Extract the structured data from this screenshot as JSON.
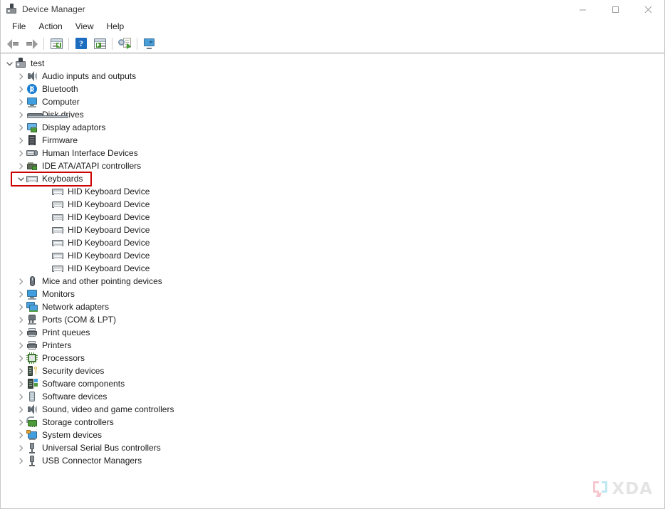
{
  "window": {
    "title": "Device Manager",
    "icon": "device-manager-icon",
    "controls": {
      "minimize": "minimize-icon",
      "maximize": "maximize-icon",
      "close": "close-icon"
    }
  },
  "menubar": {
    "items": [
      {
        "label": "File"
      },
      {
        "label": "Action"
      },
      {
        "label": "View"
      },
      {
        "label": "Help"
      }
    ]
  },
  "toolbar": {
    "buttons": [
      {
        "name": "back-button",
        "icon": "back-arrow-icon"
      },
      {
        "name": "forward-button",
        "icon": "forward-arrow-icon"
      },
      {
        "name": "show-hide-console-tree-button",
        "icon": "console-tree-icon"
      },
      {
        "name": "help-button",
        "icon": "help-question-icon"
      },
      {
        "name": "properties-button",
        "icon": "properties-window-icon"
      },
      {
        "name": "scan-for-hardware-changes-button",
        "icon": "scan-hardware-icon"
      },
      {
        "name": "update-driver-button",
        "icon": "device-properties-icon"
      }
    ]
  },
  "tree": {
    "root": {
      "label": "test",
      "icon": "computer-icon",
      "expanded": true
    },
    "nodes": [
      {
        "label": "Audio inputs and outputs",
        "icon": "speaker-icon",
        "expanded": false,
        "depth": 1
      },
      {
        "label": "Bluetooth",
        "icon": "bluetooth-icon",
        "expanded": false,
        "depth": 1
      },
      {
        "label": "Computer",
        "icon": "monitor-icon",
        "expanded": false,
        "depth": 1
      },
      {
        "label": "Disk drives",
        "icon": "disk-drive-icon",
        "expanded": false,
        "depth": 1
      },
      {
        "label": "Display adaptors",
        "icon": "display-adapter-icon",
        "expanded": false,
        "depth": 1
      },
      {
        "label": "Firmware",
        "icon": "firmware-chip-icon",
        "expanded": false,
        "depth": 1
      },
      {
        "label": "Human Interface Devices",
        "icon": "hid-icon",
        "expanded": false,
        "depth": 1
      },
      {
        "label": "IDE ATA/ATAPI controllers",
        "icon": "ide-controller-icon",
        "expanded": false,
        "depth": 1
      },
      {
        "label": "Keyboards",
        "icon": "keyboard-icon",
        "expanded": true,
        "depth": 1,
        "highlighted": true
      },
      {
        "label": "HID Keyboard Device",
        "icon": "keyboard-icon",
        "depth": 2
      },
      {
        "label": "HID Keyboard Device",
        "icon": "keyboard-icon",
        "depth": 2
      },
      {
        "label": "HID Keyboard Device",
        "icon": "keyboard-icon",
        "depth": 2
      },
      {
        "label": "HID Keyboard Device",
        "icon": "keyboard-icon",
        "depth": 2
      },
      {
        "label": "HID Keyboard Device",
        "icon": "keyboard-icon",
        "depth": 2
      },
      {
        "label": "HID Keyboard Device",
        "icon": "keyboard-icon",
        "depth": 2
      },
      {
        "label": "HID Keyboard Device",
        "icon": "keyboard-icon",
        "depth": 2
      },
      {
        "label": "Mice and other pointing devices",
        "icon": "mouse-icon",
        "expanded": false,
        "depth": 1
      },
      {
        "label": "Monitors",
        "icon": "monitor-icon",
        "expanded": false,
        "depth": 1
      },
      {
        "label": "Network adapters",
        "icon": "network-adapter-icon",
        "expanded": false,
        "depth": 1
      },
      {
        "label": "Ports (COM & LPT)",
        "icon": "port-icon",
        "expanded": false,
        "depth": 1
      },
      {
        "label": "Print queues",
        "icon": "printer-icon",
        "expanded": false,
        "depth": 1
      },
      {
        "label": "Printers",
        "icon": "printer-icon",
        "expanded": false,
        "depth": 1
      },
      {
        "label": "Processors",
        "icon": "processor-icon",
        "expanded": false,
        "depth": 1
      },
      {
        "label": "Security devices",
        "icon": "security-device-icon",
        "expanded": false,
        "depth": 1
      },
      {
        "label": "Software components",
        "icon": "software-component-icon",
        "expanded": false,
        "depth": 1
      },
      {
        "label": "Software devices",
        "icon": "software-device-icon",
        "expanded": false,
        "depth": 1
      },
      {
        "label": "Sound, video and game controllers",
        "icon": "speaker-icon",
        "expanded": false,
        "depth": 1
      },
      {
        "label": "Storage controllers",
        "icon": "storage-controller-icon",
        "expanded": false,
        "depth": 1
      },
      {
        "label": "System devices",
        "icon": "system-device-icon",
        "expanded": false,
        "depth": 1
      },
      {
        "label": "Universal Serial Bus controllers",
        "icon": "usb-icon",
        "expanded": false,
        "depth": 1
      },
      {
        "label": "USB Connector Managers",
        "icon": "usb-icon",
        "expanded": false,
        "depth": 1
      }
    ]
  },
  "highlight": {
    "color": "#cc0000",
    "target": "Keyboards"
  },
  "watermark": {
    "text": "XDA"
  }
}
